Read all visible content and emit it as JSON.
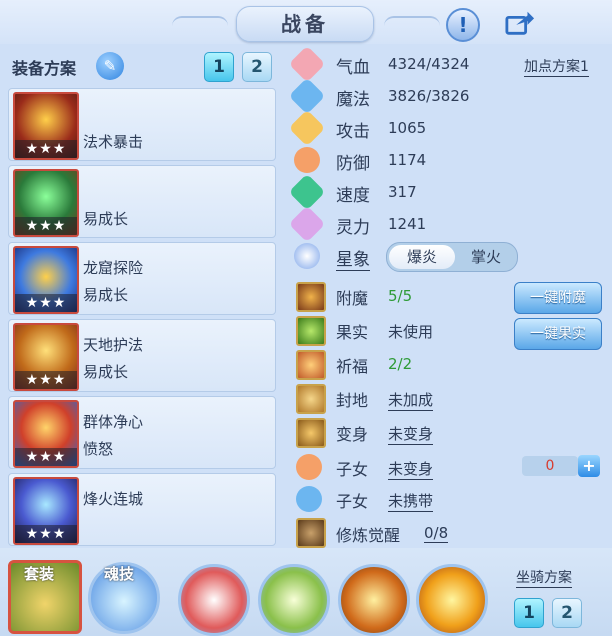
{
  "header": {
    "title": "战备"
  },
  "equip": {
    "label": "装备方案",
    "plan_buttons": [
      "1",
      "2"
    ],
    "slots": [
      {
        "line1": "",
        "line2": "法术暴击",
        "stars": "★★★"
      },
      {
        "line1": "",
        "line2": "易成长",
        "stars": "★★★"
      },
      {
        "line1": "龙窟探险",
        "line2": "易成长",
        "stars": "★★★"
      },
      {
        "line1": "天地护法",
        "line2": "易成长",
        "stars": "★★★"
      },
      {
        "line1": "群体净心",
        "line2": "愤怒",
        "stars": "★★★"
      },
      {
        "line1": "烽火连城",
        "line2": "",
        "stars": "★★★"
      }
    ]
  },
  "stats": {
    "plan_link": "加点方案1",
    "items": [
      {
        "name": "气血",
        "value": "4324/4324",
        "icon": "heart-icon",
        "color": "#f07a8a"
      },
      {
        "name": "魔法",
        "value": "3826/3826",
        "icon": "mana-icon",
        "color": "#4aa8ea"
      },
      {
        "name": "攻击",
        "value": "1065",
        "icon": "sword-icon",
        "color": "#f4b547"
      },
      {
        "name": "防御",
        "value": "1174",
        "icon": "shield-icon",
        "color": "#f59b5f"
      },
      {
        "name": "速度",
        "value": "317",
        "icon": "speed-icon",
        "color": "#39c18b"
      },
      {
        "name": "灵力",
        "value": "1241",
        "icon": "spirit-icon",
        "color": "#d79be6"
      }
    ],
    "star_label": "星象",
    "star_options": [
      "爆炎",
      "掌火"
    ]
  },
  "extras": [
    {
      "name": "附魔",
      "value": "5/5"
    },
    {
      "name": "果实",
      "value": "未使用"
    },
    {
      "name": "祈福",
      "value": "2/2"
    },
    {
      "name": "封地",
      "value": "未加成"
    },
    {
      "name": "变身",
      "value": "未变身"
    },
    {
      "name": "子女",
      "value": "未变身"
    },
    {
      "name": "子女",
      "value": "未携带"
    },
    {
      "name": "修炼觉醒",
      "value": "0/8"
    }
  ],
  "actions": {
    "enchant": "一键附魔",
    "fruit": "一键果实"
  },
  "stepper": {
    "value": "0",
    "plus": "+"
  },
  "bottom": {
    "set_label": "套装",
    "soul_label": "魂技",
    "mount_label": "坐骑方案",
    "mount_buttons": [
      "1",
      "2"
    ]
  }
}
